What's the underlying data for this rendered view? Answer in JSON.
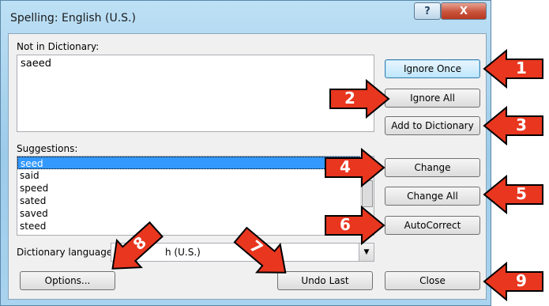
{
  "window": {
    "title": "Spelling: English (U.S.)",
    "help_glyph": "?",
    "close_glyph": "X"
  },
  "not_in_dictionary": {
    "label": "Not in Dictionary:",
    "value": "saeed"
  },
  "suggestions": {
    "label": "Suggestions:",
    "items": [
      "seed",
      "said",
      "speed",
      "sated",
      "saved",
      "steed"
    ],
    "selected": "seed"
  },
  "dictionary_language": {
    "label": "Dictionary language:",
    "value": "English (U.S.)",
    "visible_value": "h (U.S.)"
  },
  "buttons": {
    "ignore_once": "Ignore Once",
    "ignore_all": "Ignore All",
    "add_to_dictionary": "Add to Dictionary",
    "change": "Change",
    "change_all": "Change All",
    "autocorrect": "AutoCorrect",
    "options": "Options...",
    "undo_last": "Undo Last",
    "close": "Close"
  },
  "callouts": [
    "1",
    "2",
    "3",
    "4",
    "5",
    "6",
    "7",
    "8",
    "9"
  ],
  "colors": {
    "callout_fill": "#e8361f",
    "callout_stroke": "#000000",
    "selection": "#3399ff"
  }
}
